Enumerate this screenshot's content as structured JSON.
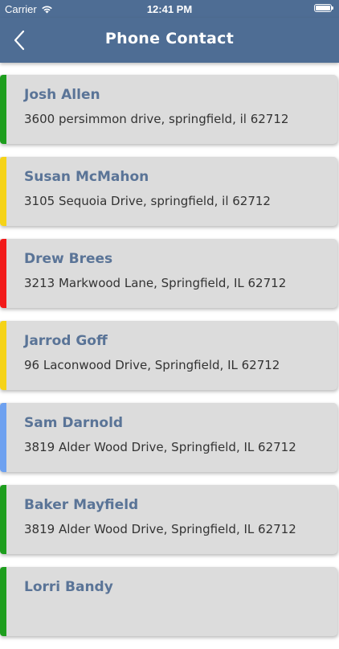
{
  "status_bar": {
    "carrier": "Carrier",
    "time": "12:41 PM",
    "icons": [
      "wifi-icon",
      "battery-icon"
    ]
  },
  "nav": {
    "title": "Phone Contact",
    "back_icon": "chevron-left-icon"
  },
  "colors": {
    "nav_background": "#4e6d94",
    "card_background": "#dcdcdc",
    "name_text": "#5a7497"
  },
  "contacts": [
    {
      "name": "Josh Allen",
      "address": "3600 persimmon drive, springfield, il 62712",
      "color": "#1e9e1e"
    },
    {
      "name": "Susan McMahon",
      "address": "3105 Sequoia Drive, springfield, il 62712",
      "color": "#f5d318"
    },
    {
      "name": "Drew Brees",
      "address": "3213 Markwood Lane, Springfield, IL 62712",
      "color": "#f21a1a"
    },
    {
      "name": "Jarrod Goff",
      "address": "96 Laconwood Drive, Springfield, IL 62712",
      "color": "#f5d318"
    },
    {
      "name": "Sam Darnold",
      "address": "3819 Alder Wood Drive, Springfield, IL 62712",
      "color": "#6ea1f0"
    },
    {
      "name": "Baker Mayfield",
      "address": "3819 Alder Wood Drive, Springfield, IL 62712",
      "color": "#1e9e1e"
    },
    {
      "name": "Lorri Bandy",
      "address": "",
      "color": "#1e9e1e"
    }
  ]
}
